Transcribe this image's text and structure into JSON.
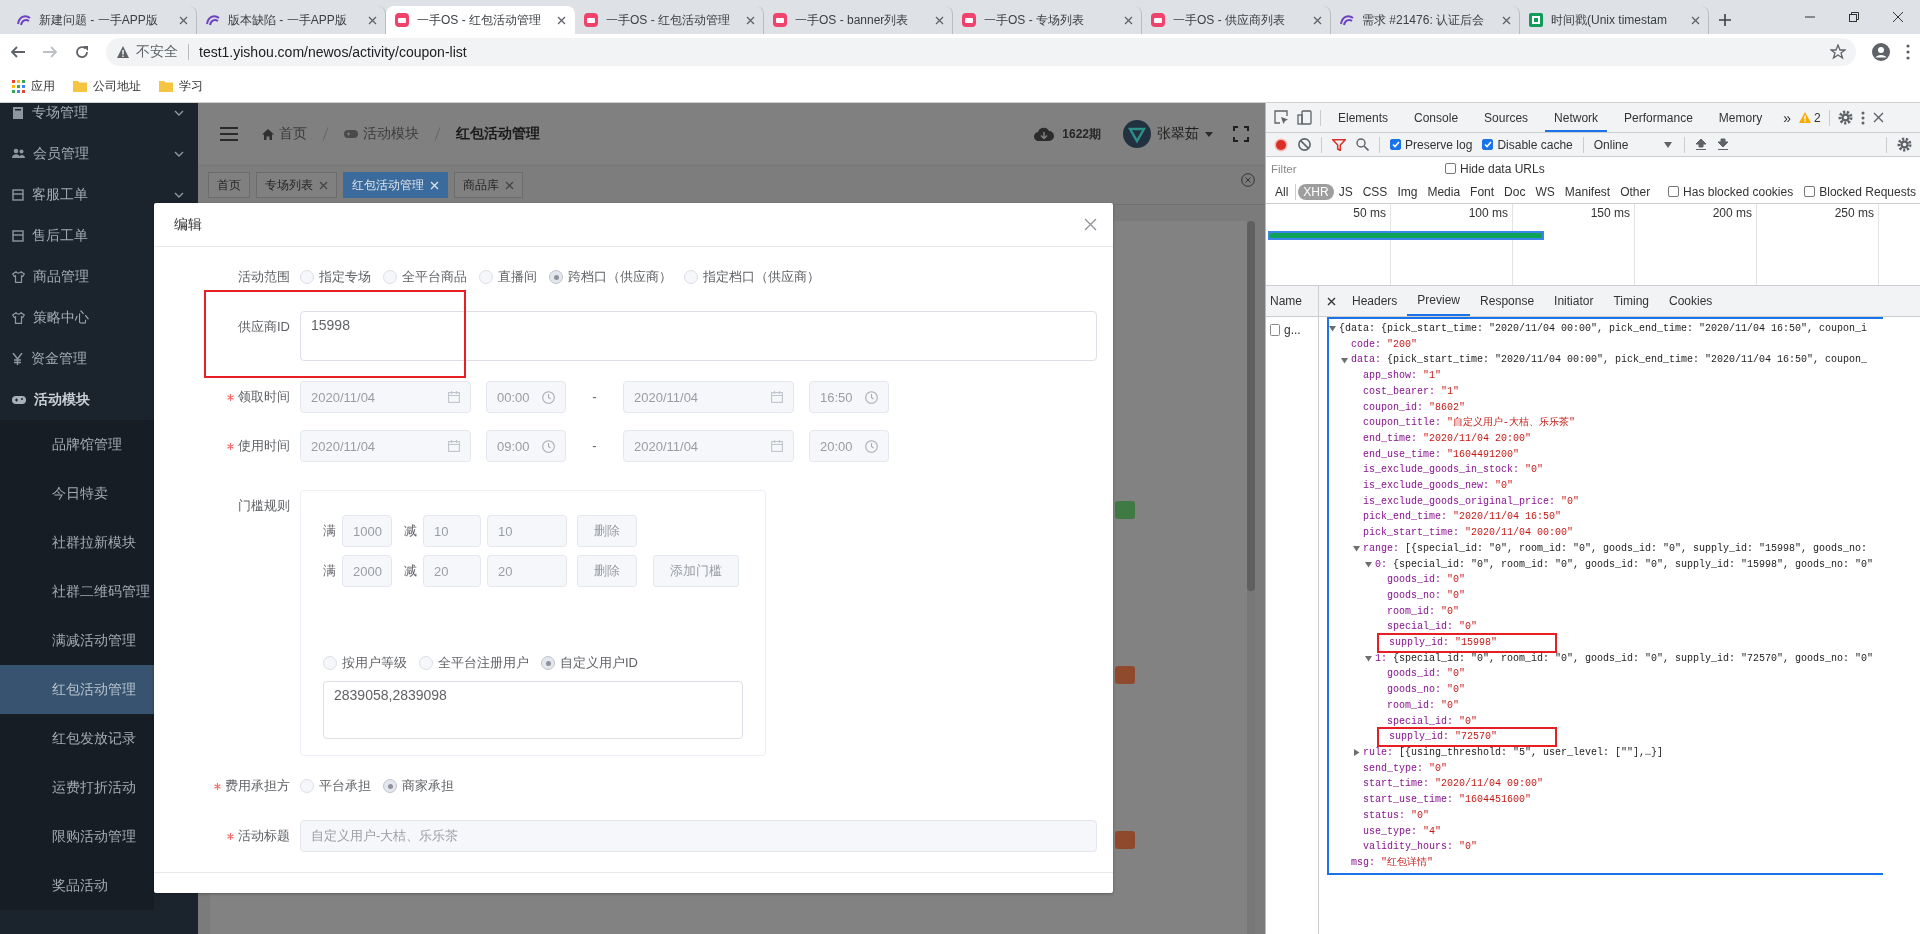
{
  "browser": {
    "tabs": [
      {
        "title": "新建问题 - 一手APP版",
        "kind": "tracker",
        "selected": false
      },
      {
        "title": "版本缺陷 - 一手APP版",
        "kind": "tracker",
        "selected": false
      },
      {
        "title": "一手OS - 红包活动管理",
        "kind": "app",
        "selected": true
      },
      {
        "title": "一手OS - 红包活动管理",
        "kind": "app",
        "selected": false
      },
      {
        "title": "一手OS - banner列表",
        "kind": "app",
        "selected": false
      },
      {
        "title": "一手OS - 专场列表",
        "kind": "app",
        "selected": false
      },
      {
        "title": "一手OS - 供应商列表",
        "kind": "app",
        "selected": false
      },
      {
        "title": "需求 #21476: 认证后会",
        "kind": "tracker",
        "selected": false
      },
      {
        "title": "时间戳(Unix timestam",
        "kind": "sheet",
        "selected": false
      }
    ],
    "security": "不安全",
    "url": "test1.yishou.com/newos/activity/coupon-list",
    "bookmarks": [
      {
        "label": "应用",
        "kind": "apps"
      },
      {
        "label": "公司地址",
        "kind": "folder"
      },
      {
        "label": "学习",
        "kind": "folder"
      }
    ]
  },
  "sidebar": {
    "items": [
      {
        "label": "专场管理",
        "kind": "book",
        "expanded": false
      },
      {
        "label": "会员管理",
        "kind": "users",
        "expanded": false
      },
      {
        "label": "客服工单",
        "kind": "box",
        "expanded": false
      },
      {
        "label": "售后工单",
        "kind": "box"
      },
      {
        "label": "商品管理",
        "kind": "shirt"
      },
      {
        "label": "策略中心",
        "kind": "shirt"
      },
      {
        "label": "资金管理",
        "kind": "yen"
      },
      {
        "label": "活动模块",
        "kind": "gamepad",
        "children": [
          {
            "label": "品牌馆管理",
            "selected": false
          },
          {
            "label": "今日特卖",
            "selected": false
          },
          {
            "label": "社群拉新模块",
            "selected": false
          },
          {
            "label": "社群二维码管理",
            "selected": false
          },
          {
            "label": "满减活动管理",
            "selected": false
          },
          {
            "label": "红包活动管理",
            "selected": true
          },
          {
            "label": "红包发放记录",
            "selected": false
          },
          {
            "label": "运费打折活动",
            "selected": false
          },
          {
            "label": "限购活动管理",
            "selected": false
          },
          {
            "label": "奖品活动",
            "selected": false
          }
        ]
      }
    ]
  },
  "header": {
    "breadcrumb": [
      {
        "label": "首页",
        "kind": "home"
      },
      {
        "label": "活动模块",
        "kind": "gamepad"
      },
      {
        "label": "红包活动管理",
        "kind": "current"
      }
    ],
    "issue": "1622期",
    "user": "张翠茹"
  },
  "tags": [
    {
      "label": "首页",
      "closable": false,
      "selected": false
    },
    {
      "label": "专场列表",
      "closable": true,
      "selected": false
    },
    {
      "label": "红包活动管理",
      "closable": true,
      "selected": true
    },
    {
      "label": "商品库",
      "closable": true,
      "selected": false
    }
  ],
  "background_tags": [
    {
      "color": "#3f7a45"
    },
    {
      "color": "#8f4a2e"
    },
    {
      "color": "#8f4a2e"
    }
  ],
  "dialog": {
    "title": "编辑",
    "scope": {
      "label": "活动范围",
      "options": [
        {
          "label": "指定专场",
          "selected": false
        },
        {
          "label": "全平台商品",
          "selected": false
        },
        {
          "label": "直播间",
          "selected": false
        },
        {
          "label": "跨档口（供应商）",
          "selected": true
        },
        {
          "label": "指定档口（供应商）",
          "selected": false
        }
      ]
    },
    "supplier_id": {
      "label": "供应商ID",
      "value": "15998",
      "highlighted": true
    },
    "receive_time": {
      "label": "领取时间",
      "required": true,
      "disabled": true,
      "start_date": "2020/11/04",
      "start_time": "00:00",
      "separator": "-",
      "end_date": "2020/11/04",
      "end_time": "16:50"
    },
    "use_time": {
      "label": "使用时间",
      "required": true,
      "disabled": true,
      "start_date": "2020/11/04",
      "start_time": "09:00",
      "separator": "-",
      "end_date": "2020/11/04",
      "end_time": "20:00"
    },
    "threshold": {
      "label": "门槛规则",
      "disabled": true,
      "rules": [
        {
          "full_label": "满",
          "full": "1000",
          "minus_label": "减",
          "minus": "10",
          "amount": "10",
          "delete": "删除"
        },
        {
          "full_label": "满",
          "full": "2000",
          "minus_label": "减",
          "minus": "20",
          "amount": "20",
          "delete": "删除"
        }
      ],
      "add": "添加门槛",
      "user_scope": [
        {
          "label": "按用户等级",
          "selected": false
        },
        {
          "label": "全平台注册用户",
          "selected": false
        },
        {
          "label": "自定义用户ID",
          "selected": true
        }
      ],
      "user_ids": "2839058,2839098"
    },
    "cost_bearer": {
      "label": "费用承担方",
      "required": true,
      "options": [
        {
          "label": "平台承担",
          "selected": false
        },
        {
          "label": "商家承担",
          "selected": true
        }
      ]
    },
    "title_field": {
      "label": "活动标题",
      "required": true,
      "disabled": true,
      "value": "自定义用户-大桔、乐乐茶"
    }
  },
  "devtools": {
    "tabs": [
      {
        "label": "Elements",
        "selected": false
      },
      {
        "label": "Console",
        "selected": false
      },
      {
        "label": "Sources",
        "selected": false
      },
      {
        "label": "Network",
        "selected": true
      },
      {
        "label": "Performance",
        "selected": false
      },
      {
        "label": "Memory",
        "selected": false
      }
    ],
    "more": "»",
    "warnings": "2",
    "checks": [
      {
        "label": "Preserve log",
        "checked": true
      },
      {
        "label": "Disable cache",
        "checked": true
      }
    ],
    "throttle": "Online",
    "filter_placeholder": "Filter",
    "hide_data_urls": {
      "label": "Hide data URLs",
      "checked": false
    },
    "types": [
      {
        "label": "All",
        "selected": false
      },
      {
        "label": "XHR",
        "selected": true
      },
      {
        "label": "JS",
        "selected": false
      },
      {
        "label": "CSS",
        "selected": false
      },
      {
        "label": "Img",
        "selected": false
      },
      {
        "label": "Media",
        "selected": false
      },
      {
        "label": "Font",
        "selected": false
      },
      {
        "label": "Doc",
        "selected": false
      },
      {
        "label": "WS",
        "selected": false
      },
      {
        "label": "Manifest",
        "selected": false
      },
      {
        "label": "Other",
        "selected": false
      }
    ],
    "type_checks": [
      {
        "label": "Has blocked cookies",
        "checked": false
      },
      {
        "label": "Blocked Requests",
        "checked": false
      }
    ],
    "ticks": [
      "50 ms",
      "100 ms",
      "150 ms",
      "200 ms",
      "250 ms"
    ],
    "name_header": "Name",
    "requests": [
      {
        "name": "g..."
      }
    ],
    "detail_tabs": [
      {
        "label": "Headers",
        "selected": false
      },
      {
        "label": "Preview",
        "selected": true
      },
      {
        "label": "Response",
        "selected": false
      },
      {
        "label": "Initiator",
        "selected": false
      },
      {
        "label": "Timing",
        "selected": false
      },
      {
        "label": "Cookies",
        "selected": false
      }
    ],
    "preview": {
      "summary": "{data: {pick_start_time: \"2020/11/04 00:00\", pick_end_time: \"2020/11/04 16:50\", coupon_i",
      "expanded": true,
      "children": [
        {
          "key": "code:",
          "value": "\"200\""
        },
        {
          "key": "data:",
          "summary": "{pick_start_time: \"2020/11/04 00:00\", pick_end_time: \"2020/11/04 16:50\", coupon_",
          "expanded": true,
          "children": [
            {
              "key": "app_show:",
              "value": "\"1\""
            },
            {
              "key": "cost_bearer:",
              "value": "\"1\""
            },
            {
              "key": "coupon_id:",
              "value": "\"8602\""
            },
            {
              "key": "coupon_title:",
              "value": "\"自定义用户-大桔、乐乐茶\""
            },
            {
              "key": "end_time:",
              "value": "\"2020/11/04 20:00\""
            },
            {
              "key": "end_use_time:",
              "value": "\"1604491200\""
            },
            {
              "key": "is_exclude_goods_in_stock:",
              "value": "\"0\""
            },
            {
              "key": "is_exclude_goods_new:",
              "value": "\"0\""
            },
            {
              "key": "is_exclude_goods_original_price:",
              "value": "\"0\""
            },
            {
              "key": "pick_end_time:",
              "value": "\"2020/11/04 16:50\""
            },
            {
              "key": "pick_start_time:",
              "value": "\"2020/11/04 00:00\""
            },
            {
              "key": "range:",
              "summary": "[{special_id: \"0\", room_id: \"0\", goods_id: \"0\", supply_id: \"15998\", goods_no:",
              "expanded": true,
              "children": [
                {
                  "key": "0:",
                  "summary": "{special_id: \"0\", room_id: \"0\", goods_id: \"0\", supply_id: \"15998\", goods_no: \"0\"",
                  "expanded": true,
                  "children": [
                    {
                      "key": "goods_id:",
                      "value": "\"0\"",
                      "highlighted": false
                    },
                    {
                      "key": "goods_no:",
                      "value": "\"0\"",
                      "highlighted": false
                    },
                    {
                      "key": "room_id:",
                      "value": "\"0\"",
                      "highlighted": false
                    },
                    {
                      "key": "special_id:",
                      "value": "\"0\"",
                      "highlighted": false
                    },
                    {
                      "key": "supply_id:",
                      "value": "\"15998\"",
                      "highlighted": true
                    }
                  ]
                },
                {
                  "key": "1:",
                  "summary": "{special_id: \"0\", room_id: \"0\", goods_id: \"0\", supply_id: \"72570\", goods_no: \"0\"",
                  "expanded": true,
                  "children": [
                    {
                      "key": "goods_id:",
                      "value": "\"0\"",
                      "highlighted": false
                    },
                    {
                      "key": "goods_no:",
                      "value": "\"0\"",
                      "highlighted": false
                    },
                    {
                      "key": "room_id:",
                      "value": "\"0\"",
                      "highlighted": false
                    },
                    {
                      "key": "special_id:",
                      "value": "\"0\"",
                      "highlighted": false
                    },
                    {
                      "key": "supply_id:",
                      "value": "\"72570\"",
                      "highlighted": true
                    }
                  ]
                }
              ]
            },
            {
              "key": "rule:",
              "summary": "[{using_threshold: \"5\", user_level: [\"\"],…}]",
              "expanded": false
            },
            {
              "key": "send_type:",
              "value": "\"0\""
            },
            {
              "key": "start_time:",
              "value": "\"2020/11/04 09:00\""
            },
            {
              "key": "start_use_time:",
              "value": "\"1604451600\""
            },
            {
              "key": "status:",
              "value": "\"0\""
            },
            {
              "key": "use_type:",
              "value": "\"4\""
            },
            {
              "key": "validity_hours:",
              "value": "\"0\""
            }
          ]
        },
        {
          "key": "msg:",
          "value": "\"红包详情\""
        }
      ]
    }
  }
}
